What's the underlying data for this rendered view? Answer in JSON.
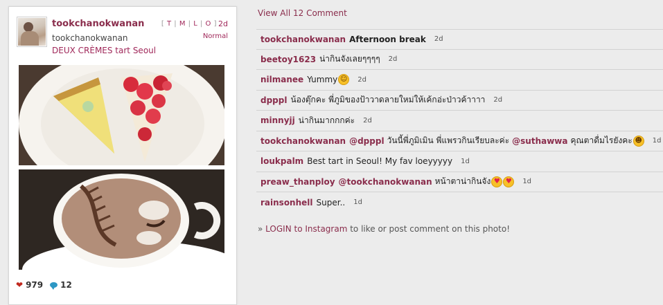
{
  "post": {
    "username": "tookchanokwanan",
    "fullname": "tookchanokwanan",
    "caption": "DEUX CRÈMES tart Seoul",
    "size_links": [
      "T",
      "M",
      "L",
      "O"
    ],
    "age": "2d",
    "filter": "Normal",
    "likes": "979",
    "comments": "12"
  },
  "view_all": "View All 12 Comment",
  "comments": [
    {
      "user": "tookchanokwanan",
      "text": "Afternoon break",
      "age": "2d"
    },
    {
      "user": "beetoy1623",
      "text": "น่ากินจังเลยๆๆๆๆ",
      "age": "2d"
    },
    {
      "user": "nilmanee",
      "text": "Yummy",
      "age": "2d"
    },
    {
      "user": "dpppl",
      "text": "น้องตุ๊กคะ พี่ภูมิของป้าวาดลายใหม่ให้เค้กอ่ะป่าวค้าาาา",
      "age": "2d"
    },
    {
      "user": "minnyjj",
      "text": "น่ากินมากกกค่ะ",
      "age": "2d"
    },
    {
      "user": "tookchanokwanan",
      "mention1": "@dpppl",
      "text": "วันนี้พี่ภูมิเมิน พี่แพรวกินเรียบละค่ะ",
      "mention2": "@suthawwa",
      "text2": "คุณตาดื่มไรยังคะ",
      "age": "1d"
    },
    {
      "user": "loukpalm",
      "text": "Best tart in Seoul! My fav loeyyyyy",
      "age": "1d"
    },
    {
      "user": "preaw_thanploy",
      "mention1": "@tookchanokwanan",
      "text": "หน้าตาน่ากินจัง",
      "age": "1d"
    },
    {
      "user": "rainsonhell",
      "text": "Super..",
      "age": "1d"
    }
  ],
  "login": {
    "prefix": "» ",
    "link": "LOGIN to Instagram",
    "suffix": " to like or post comment on this photo!"
  },
  "colors": {
    "accent": "#8a2d4c",
    "link": "#a0285a",
    "heart": "#c0281e",
    "bubble": "#2d97c4"
  },
  "icons": {
    "likes": "heart-icon",
    "comments": "comment-bubble-icon",
    "emoji": "smiley-emoji-icon"
  }
}
